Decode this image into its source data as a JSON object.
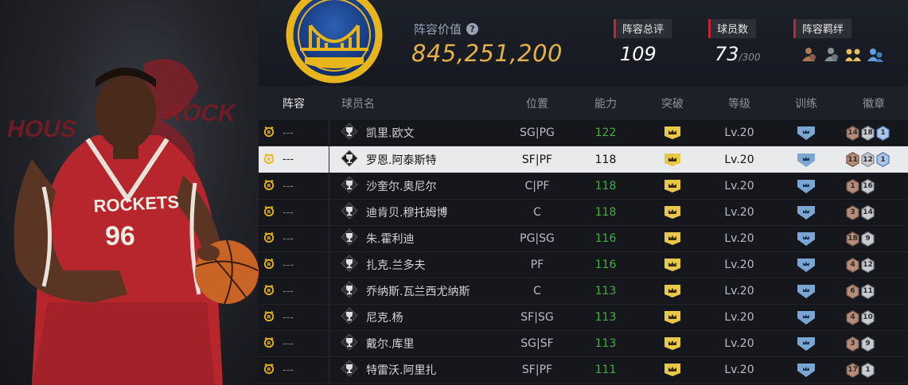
{
  "header": {
    "value_label": "阵容价值",
    "value": "845,251,200",
    "overall_label": "阵容总评",
    "overall": "109",
    "players_label": "球员数",
    "players_count": "73",
    "players_max": "/300",
    "bonds_label": "阵容羁绊"
  },
  "hero": {
    "jersey_team": "ROCKETS",
    "jersey_number": "96",
    "backdrop_left": "HOUS",
    "backdrop_right": "ROCK"
  },
  "columns": [
    "阵容",
    "球员名",
    "位置",
    "能力",
    "突破",
    "等级",
    "训练",
    "徽章"
  ],
  "colors": {
    "accent_gold": "#e6b247",
    "ability_green": "#3fae3c",
    "label_red": "#c9242b",
    "training_blue": "#7aa6d6"
  },
  "rows": [
    {
      "lineup": "---",
      "name": "凯里.欧文",
      "pos": "SG|PG",
      "ability": "122",
      "level": "Lv.20",
      "badges": [
        {
          "n": "14",
          "t": "bronze"
        },
        {
          "n": "18",
          "t": "silver"
        },
        {
          "n": "1",
          "t": "blue"
        }
      ]
    },
    {
      "lineup": "---",
      "name": "罗恩.阿泰斯特",
      "pos": "SF|PF",
      "ability": "118",
      "level": "Lv.20",
      "badges": [
        {
          "n": "11",
          "t": "bronze"
        },
        {
          "n": "12",
          "t": "silver"
        },
        {
          "n": "1",
          "t": "blue"
        }
      ]
    },
    {
      "lineup": "---",
      "name": "沙奎尔.奥尼尔",
      "pos": "C|PF",
      "ability": "118",
      "level": "Lv.20",
      "badges": [
        {
          "n": "1",
          "t": "bronze"
        },
        {
          "n": "16",
          "t": "silver"
        }
      ]
    },
    {
      "lineup": "---",
      "name": "迪肯贝.穆托姆博",
      "pos": "C",
      "ability": "118",
      "level": "Lv.20",
      "badges": [
        {
          "n": "3",
          "t": "bronze"
        },
        {
          "n": "14",
          "t": "silver"
        }
      ]
    },
    {
      "lineup": "---",
      "name": "朱.霍利迪",
      "pos": "PG|SG",
      "ability": "116",
      "level": "Lv.20",
      "badges": [
        {
          "n": "18",
          "t": "bronze"
        },
        {
          "n": "9",
          "t": "silver"
        }
      ]
    },
    {
      "lineup": "---",
      "name": "扎克.兰多夫",
      "pos": "PF",
      "ability": "116",
      "level": "Lv.20",
      "badges": [
        {
          "n": "4",
          "t": "bronze"
        },
        {
          "n": "12",
          "t": "silver"
        }
      ]
    },
    {
      "lineup": "---",
      "name": "乔纳斯.瓦兰西尤纳斯",
      "pos": "C",
      "ability": "113",
      "level": "Lv.20",
      "badges": [
        {
          "n": "6",
          "t": "bronze"
        },
        {
          "n": "11",
          "t": "silver"
        }
      ]
    },
    {
      "lineup": "---",
      "name": "尼克.杨",
      "pos": "SF|SG",
      "ability": "113",
      "level": "Lv.20",
      "badges": [
        {
          "n": "4",
          "t": "bronze"
        },
        {
          "n": "10",
          "t": "silver"
        }
      ]
    },
    {
      "lineup": "---",
      "name": "戴尔.库里",
      "pos": "SG|SF",
      "ability": "113",
      "level": "Lv.20",
      "badges": [
        {
          "n": "3",
          "t": "bronze"
        },
        {
          "n": "9",
          "t": "silver"
        }
      ]
    },
    {
      "lineup": "---",
      "name": "特雷沃.阿里扎",
      "pos": "SF|PF",
      "ability": "111",
      "level": "Lv.20",
      "badges": [
        {
          "n": "17",
          "t": "bronze"
        },
        {
          "n": "1",
          "t": "silver"
        }
      ]
    }
  ],
  "selected_row": 1
}
